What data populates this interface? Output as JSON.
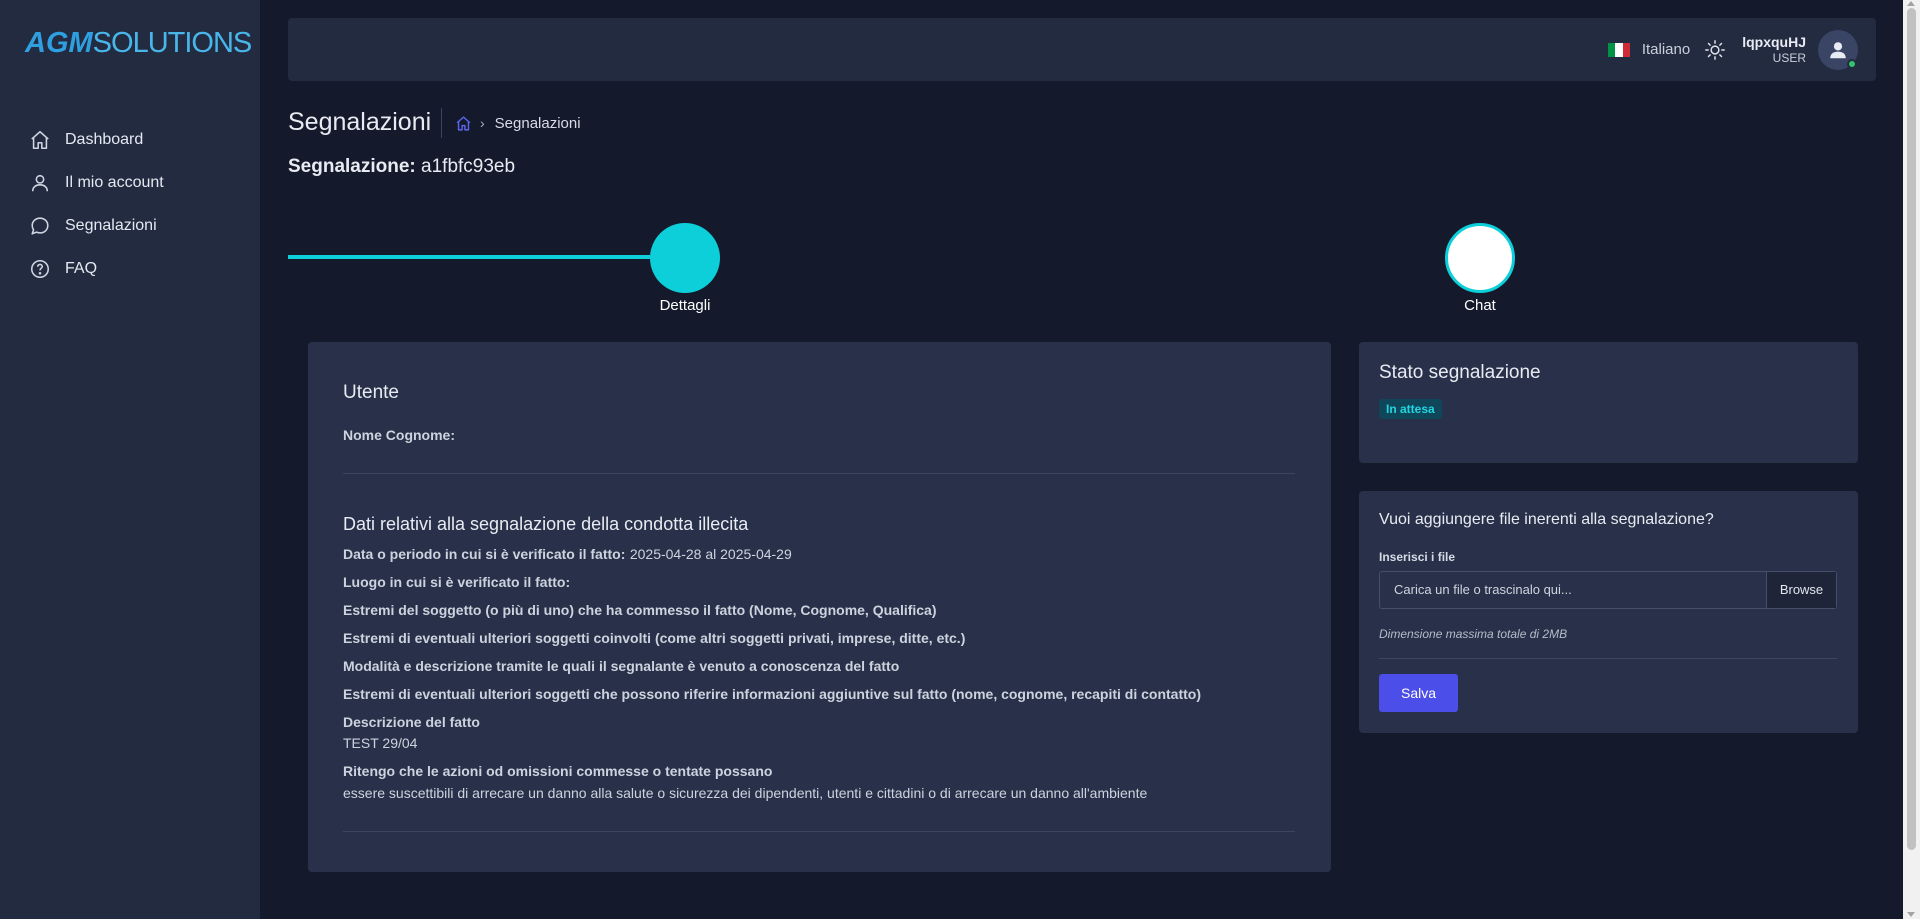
{
  "brand": {
    "logo_a": "AGM",
    "logo_b": "SOLUTIONS"
  },
  "sidebar": {
    "items": [
      {
        "label": "Dashboard",
        "icon": "home-icon"
      },
      {
        "label": "Il mio account",
        "icon": "user-icon"
      },
      {
        "label": "Segnalazioni",
        "icon": "chat-icon"
      },
      {
        "label": "FAQ",
        "icon": "help-icon"
      }
    ]
  },
  "topbar": {
    "language": "Italiano",
    "flag_colors": [
      "#009246",
      "#ffffff",
      "#ce2b37"
    ],
    "username": "lqpxquHJ",
    "role": "USER",
    "status_color": "#33c36a"
  },
  "header": {
    "title": "Segnalazioni",
    "breadcrumb": "Segnalazioni",
    "report_label": "Segnalazione:",
    "report_id": "a1fbfc93eb"
  },
  "stepper": {
    "steps": [
      "Dettagli",
      "Chat"
    ],
    "accent": "#0ccfd9"
  },
  "user_section": {
    "title": "Utente",
    "name_label": "Nome Cognome:"
  },
  "details": {
    "title": "Dati relativi alla segnalazione della condotta illecita",
    "date_label": "Data o periodo in cui si è verificato il fatto:",
    "date_value": "2025-04-28 al 2025-04-29",
    "place_label": "Luogo in cui si è verificato il fatto:",
    "subject_label": "Estremi del soggetto (o più di uno) che ha commesso il fatto (Nome, Cognome, Qualifica)",
    "others_label": "Estremi di eventuali ulteriori soggetti coinvolti (come altri soggetti privati, imprese, ditte, etc.)",
    "mode_label": "Modalità e descrizione tramite le quali il segnalante è venuto a conoscenza del fatto",
    "informants_label": "Estremi di eventuali ulteriori soggetti che possono riferire informazioni aggiuntive sul fatto (nome, cognome, recapiti di contatto)",
    "description_label": "Descrizione del fatto",
    "description_value": "TEST 29/04",
    "belief_label": "Ritengo che le azioni od omissioni commesse o tentate possano",
    "belief_value": "essere suscettibili di arrecare un danno alla salute o sicurezza dei dipendenti, utenti e cittadini o di arrecare un danno all'ambiente"
  },
  "status": {
    "title": "Stato segnalazione",
    "badge": "In attesa"
  },
  "files": {
    "title": "Vuoi aggiungere file inerenti alla segnalazione?",
    "input_label": "Inserisci i file",
    "placeholder": "Carica un file o trascinalo qui...",
    "browse": "Browse",
    "hint": "Dimensione massima totale di 2MB",
    "save": "Salva"
  }
}
